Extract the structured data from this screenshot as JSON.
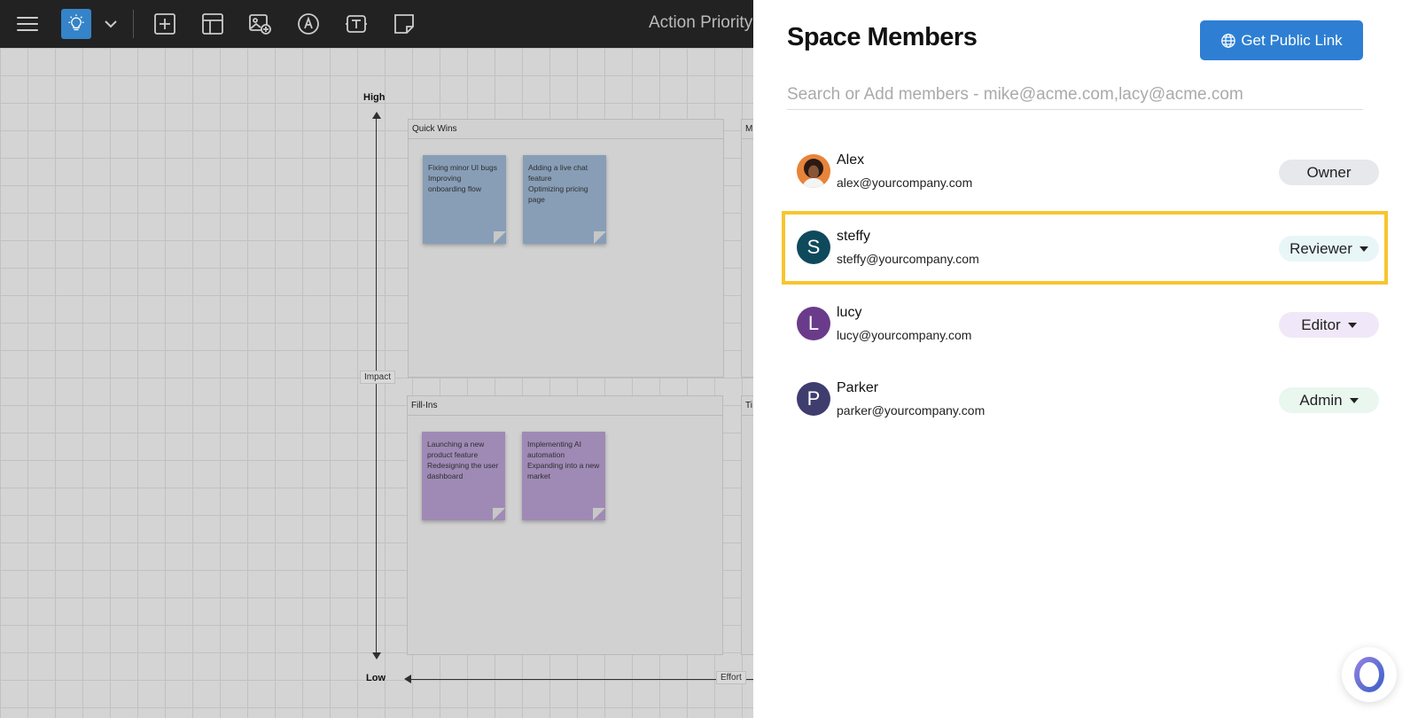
{
  "toolbar": {
    "board_title": "Action Priority"
  },
  "board": {
    "axis": {
      "high": "High",
      "low": "Low",
      "impact": "Impact",
      "effort": "Effort"
    },
    "quadrants": [
      {
        "title": "Quick Wins",
        "stickies": [
          {
            "lines": [
              "Fixing minor UI bugs",
              "Improving",
              "onboarding flow"
            ]
          },
          {
            "lines": [
              "Adding a live chat",
              "feature",
              "Optimizing pricing",
              "page"
            ]
          }
        ]
      },
      {
        "title": "Fill-Ins",
        "stickies": [
          {
            "lines": [
              "Launching a new",
              "product feature",
              "Redesigning the user",
              "dashboard"
            ]
          },
          {
            "lines": [
              "Implementing AI",
              "automation",
              "Expanding into a new",
              "market"
            ]
          }
        ]
      },
      {
        "title": "M"
      },
      {
        "title": "Ti"
      }
    ]
  },
  "panel": {
    "title": "Space Members",
    "public_link_label": "Get Public Link",
    "search_placeholder": "Search or Add members - mike@acme.com,lacy@acme.com",
    "members": [
      {
        "name": "Alex",
        "email": "alex@yourcompany.com",
        "role": "Owner",
        "initial": "",
        "avatar_color": "#e48a3a",
        "badge_color": "#e6e8eb",
        "has_dropdown": false
      },
      {
        "name": "steffy",
        "email": "steffy@yourcompany.com",
        "role": "Reviewer",
        "initial": "S",
        "avatar_color": "#0f4a5c",
        "badge_color": "#e8f6f8",
        "has_dropdown": true
      },
      {
        "name": "lucy",
        "email": "lucy@yourcompany.com",
        "role": "Editor",
        "initial": "L",
        "avatar_color": "#6a3b8a",
        "badge_color": "#f0e8f8",
        "has_dropdown": true
      },
      {
        "name": "Parker",
        "email": "parker@yourcompany.com",
        "role": "Admin",
        "initial": "P",
        "avatar_color": "#3f3d6e",
        "badge_color": "#e9f7ee",
        "has_dropdown": true
      }
    ]
  },
  "colors": {
    "accent": "#2e7fd3",
    "highlight": "#f7c52f"
  }
}
